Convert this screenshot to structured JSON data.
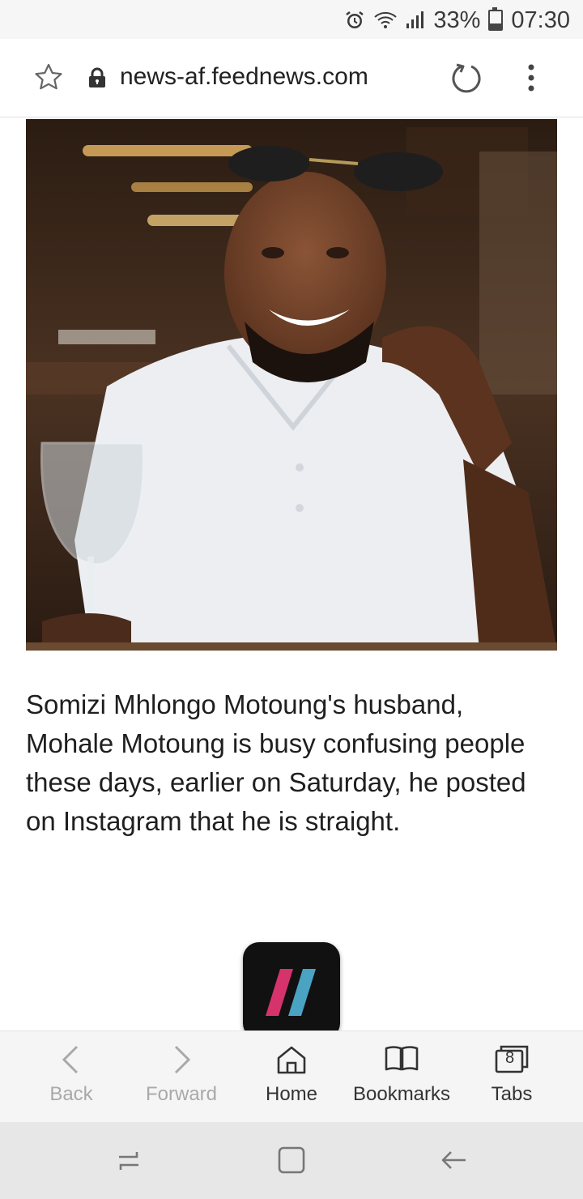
{
  "status_bar": {
    "battery_text": "33%",
    "battery_level": 0.33,
    "time": "07:30",
    "icons": [
      "alarm-icon",
      "wifi-icon",
      "signal-icon",
      "battery-icon"
    ]
  },
  "browser": {
    "url": "news-af.feednews.com",
    "icons": [
      "bookmark-star-icon",
      "lock-icon",
      "reload-icon",
      "more-menu-icon"
    ]
  },
  "article": {
    "body": "Somizi Mhlongo Motoung's husband, Mohale Motoung is busy confusing people these days, earlier on Saturday, he posted on Instagram that he is straight.",
    "image_icon": "article-photo"
  },
  "floating_app": {
    "icon": "app-shortcut-icon",
    "colors": {
      "background": "#111111",
      "pink": "#d6336c",
      "blue": "#4aa3c3"
    }
  },
  "bottom_nav": {
    "back": "Back",
    "forward": "Forward",
    "home": "Home",
    "bookmarks": "Bookmarks",
    "tabs": "Tabs",
    "tab_count": "8"
  },
  "system_nav": {
    "icons": [
      "recent-apps-icon",
      "home-square-icon",
      "back-arrow-icon"
    ]
  }
}
